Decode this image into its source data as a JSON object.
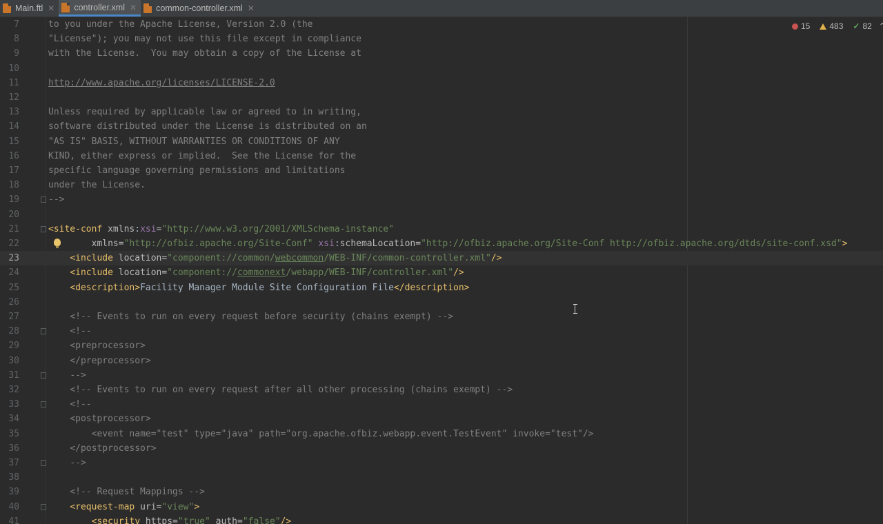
{
  "tabs": [
    {
      "label": "Main.ftl",
      "icon": "ftl-file-icon"
    },
    {
      "label": "controller.xml",
      "icon": "xml-file-icon"
    },
    {
      "label": "common-controller.xml",
      "icon": "xml-file-icon"
    }
  ],
  "active_tab": "controller.xml",
  "inspections": {
    "errors": "15",
    "warnings": "483",
    "weak_warnings": "82"
  },
  "current_line": "23",
  "lines": [
    {
      "n": "7",
      "t": [
        [
          "cm",
          "to you under the Apache License, Version 2.0 (the"
        ]
      ]
    },
    {
      "n": "8",
      "t": [
        [
          "cm",
          "\"License\"); you may not use this file except in compliance"
        ]
      ]
    },
    {
      "n": "9",
      "t": [
        [
          "cm",
          "with the License.  You may obtain a copy of the License at"
        ]
      ]
    },
    {
      "n": "10",
      "t": []
    },
    {
      "n": "11",
      "t": [
        [
          "lnk",
          "http://www.apache.org/licenses/LICENSE-2.0"
        ]
      ]
    },
    {
      "n": "12",
      "t": []
    },
    {
      "n": "13",
      "t": [
        [
          "cm",
          "Unless required by applicable law or agreed to in writing,"
        ]
      ]
    },
    {
      "n": "14",
      "t": [
        [
          "cm",
          "software distributed under the License is distributed on an"
        ]
      ]
    },
    {
      "n": "15",
      "t": [
        [
          "cm",
          "\"AS IS\" BASIS, WITHOUT WARRANTIES OR CONDITIONS OF ANY"
        ]
      ]
    },
    {
      "n": "16",
      "t": [
        [
          "cm",
          "KIND, either express or implied.  See the License for the"
        ]
      ]
    },
    {
      "n": "17",
      "t": [
        [
          "cm",
          "specific language governing permissions and limitations"
        ]
      ]
    },
    {
      "n": "18",
      "t": [
        [
          "cm",
          "under the License."
        ]
      ]
    },
    {
      "n": "19",
      "t": [
        [
          "cm",
          "-->"
        ]
      ],
      "fold": true
    },
    {
      "n": "20",
      "t": []
    },
    {
      "n": "21",
      "t": [
        [
          "tag",
          "<site-conf "
        ],
        [
          "attr",
          "xmlns"
        ],
        [
          "txt",
          ":"
        ],
        [
          "ns",
          "xsi"
        ],
        [
          "attr",
          "="
        ],
        [
          "val",
          "\"http://www.w3.org/2001/XMLSchema-instance\""
        ]
      ],
      "fold": true
    },
    {
      "n": "22",
      "t": [
        [
          "txt",
          "        "
        ],
        [
          "attr",
          "xmlns"
        ],
        [
          "attr",
          "="
        ],
        [
          "val",
          "\"http://ofbiz.apache.org/Site-Conf\" "
        ],
        [
          "ns",
          "xsi"
        ],
        [
          "txt",
          ":"
        ],
        [
          "attr",
          "schemaLocation"
        ],
        [
          "attr",
          "="
        ],
        [
          "val",
          "\"http://ofbiz.apache.org/Site-Conf http://ofbiz.apache.org/dtds/site-conf.xsd\""
        ],
        [
          "tag",
          ">"
        ]
      ],
      "bulb": true
    },
    {
      "n": "23",
      "t": [
        [
          "txt",
          "    "
        ],
        [
          "tag",
          "<include "
        ],
        [
          "attr",
          "location"
        ],
        [
          "attr",
          "="
        ],
        [
          "val",
          "\"component://common/"
        ],
        [
          "uval",
          "webcommon"
        ],
        [
          "val",
          "/WEB-INF/common-controller.xml\""
        ],
        [
          "tag",
          "/>"
        ]
      ]
    },
    {
      "n": "24",
      "t": [
        [
          "txt",
          "    "
        ],
        [
          "tag",
          "<include "
        ],
        [
          "attr",
          "location"
        ],
        [
          "attr",
          "="
        ],
        [
          "val",
          "\"component://"
        ],
        [
          "uval",
          "commonext"
        ],
        [
          "val",
          "/webapp/WEB-INF/controller.xml\""
        ],
        [
          "tag",
          "/>"
        ]
      ]
    },
    {
      "n": "25",
      "t": [
        [
          "txt",
          "    "
        ],
        [
          "tag",
          "<description>"
        ],
        [
          "txt",
          "Facility Manager Module Site Configuration File"
        ],
        [
          "tag",
          "</description>"
        ]
      ]
    },
    {
      "n": "26",
      "t": []
    },
    {
      "n": "27",
      "t": [
        [
          "txt",
          "    "
        ],
        [
          "cm",
          "<!-- Events to run on every request before security (chains exempt) -->"
        ]
      ]
    },
    {
      "n": "28",
      "t": [
        [
          "txt",
          "    "
        ],
        [
          "cm",
          "<!--"
        ]
      ],
      "fold": true
    },
    {
      "n": "29",
      "t": [
        [
          "txt",
          "    "
        ],
        [
          "cm",
          "<preprocessor>"
        ]
      ]
    },
    {
      "n": "30",
      "t": [
        [
          "txt",
          "    "
        ],
        [
          "cm",
          "</preprocessor>"
        ]
      ]
    },
    {
      "n": "31",
      "t": [
        [
          "txt",
          "    "
        ],
        [
          "cm",
          "-->"
        ]
      ],
      "fold": true
    },
    {
      "n": "32",
      "t": [
        [
          "txt",
          "    "
        ],
        [
          "cm",
          "<!-- Events to run on every request after all other processing (chains exempt) -->"
        ]
      ]
    },
    {
      "n": "33",
      "t": [
        [
          "txt",
          "    "
        ],
        [
          "cm",
          "<!--"
        ]
      ],
      "fold": true
    },
    {
      "n": "34",
      "t": [
        [
          "txt",
          "    "
        ],
        [
          "cm",
          "<postprocessor>"
        ]
      ]
    },
    {
      "n": "35",
      "t": [
        [
          "txt",
          "        "
        ],
        [
          "cm",
          "<event name=\"test\" type=\"java\" path=\"org.apache.ofbiz.webapp.event.TestEvent\" invoke=\"test\"/>"
        ]
      ]
    },
    {
      "n": "36",
      "t": [
        [
          "txt",
          "    "
        ],
        [
          "cm",
          "</postprocessor>"
        ]
      ]
    },
    {
      "n": "37",
      "t": [
        [
          "txt",
          "    "
        ],
        [
          "cm",
          "-->"
        ]
      ],
      "fold": true
    },
    {
      "n": "38",
      "t": []
    },
    {
      "n": "39",
      "t": [
        [
          "txt",
          "    "
        ],
        [
          "cm",
          "<!-- Request Mappings -->"
        ]
      ]
    },
    {
      "n": "40",
      "t": [
        [
          "txt",
          "    "
        ],
        [
          "tag",
          "<request-map "
        ],
        [
          "attr",
          "uri"
        ],
        [
          "attr",
          "="
        ],
        [
          "val",
          "\"view\""
        ],
        [
          "tag",
          ">"
        ]
      ],
      "fold": true
    },
    {
      "n": "41",
      "t": [
        [
          "txt",
          "        "
        ],
        [
          "tag",
          "<security "
        ],
        [
          "attr",
          "https"
        ],
        [
          "attr",
          "="
        ],
        [
          "val",
          "\"true\" "
        ],
        [
          "attr",
          "auth"
        ],
        [
          "attr",
          "="
        ],
        [
          "val",
          "\"false\""
        ],
        [
          "tag",
          "/>"
        ]
      ]
    }
  ]
}
